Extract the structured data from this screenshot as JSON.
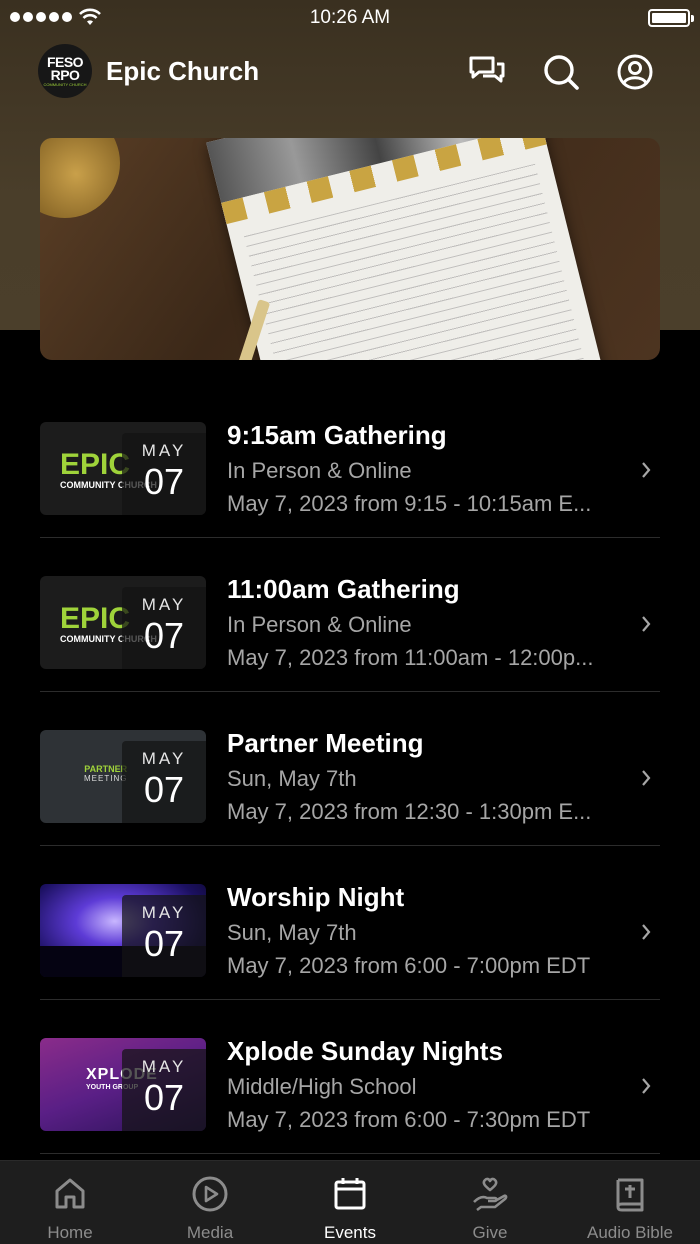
{
  "status_bar": {
    "time": "10:26 AM"
  },
  "header": {
    "title": "Epic Church",
    "logo_text": {
      "line1": "FESO",
      "line2": "RPO",
      "line3": "COMMUNITY CHURCH"
    }
  },
  "events": [
    {
      "title": "9:15am Gathering",
      "subtitle": "In Person & Online",
      "date_line": "May 7, 2023 from 9:15 - 10:15am E...",
      "month": "MAY",
      "day": "07",
      "thumb": {
        "label": "EPIC",
        "sub": "COMMUNITY CHURCH"
      }
    },
    {
      "title": "11:00am Gathering",
      "subtitle": "In Person & Online",
      "date_line": "May 7, 2023 from 11:00am - 12:00p...",
      "month": "MAY",
      "day": "07",
      "thumb": {
        "label": "EPIC",
        "sub": "COMMUNITY CHURCH"
      }
    },
    {
      "title": "Partner Meeting",
      "subtitle": "Sun, May 7th",
      "date_line": "May 7, 2023 from 12:30 - 1:30pm E...",
      "month": "MAY",
      "day": "07",
      "thumb": {
        "label": "PARTNER",
        "sub": "MEETING"
      }
    },
    {
      "title": "Worship Night",
      "subtitle": "Sun, May 7th",
      "date_line": "May 7, 2023 from 6:00 - 7:00pm EDT",
      "month": "MAY",
      "day": "07",
      "thumb": {
        "label": "",
        "sub": ""
      }
    },
    {
      "title": "Xplode Sunday Nights",
      "subtitle": "Middle/High School",
      "date_line": "May 7, 2023 from 6:00 - 7:30pm EDT",
      "month": "MAY",
      "day": "07",
      "thumb": {
        "label": "XPLODE",
        "sub": "YOUTH GROUP"
      }
    }
  ],
  "tabs": [
    {
      "label": "Home",
      "icon": "home-icon"
    },
    {
      "label": "Media",
      "icon": "play-icon"
    },
    {
      "label": "Events",
      "icon": "calendar-icon",
      "active": true
    },
    {
      "label": "Give",
      "icon": "give-icon"
    },
    {
      "label": "Audio Bible",
      "icon": "bible-icon"
    }
  ],
  "colors": {
    "accent_green": "#9fd33a",
    "header_brown": "#4a3e2a",
    "muted_text": "#a6a6a6"
  }
}
